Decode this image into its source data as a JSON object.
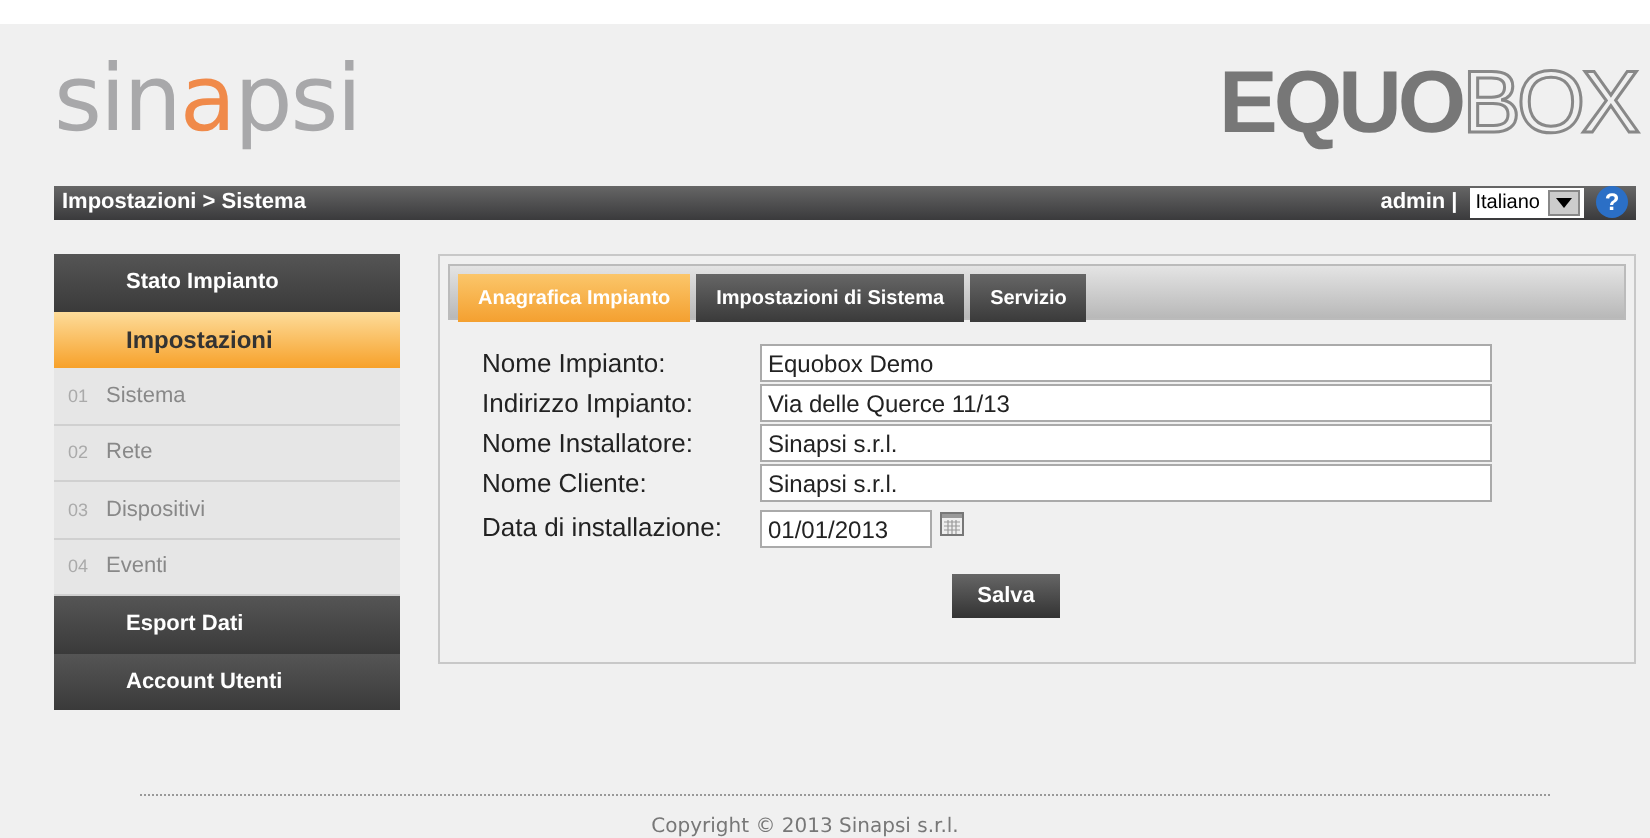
{
  "logo": {
    "parts": [
      {
        "text": "sin",
        "accent": false
      },
      {
        "text": "a",
        "accent": true
      },
      {
        "text": "psi",
        "accent": false
      }
    ]
  },
  "brand": {
    "parts": [
      {
        "text": "EQUO",
        "outline": false
      },
      {
        "text": "BOX",
        "outline": true
      }
    ]
  },
  "header": {
    "breadcrumb": "Impostazioni > Sistema",
    "user": "admin |",
    "language": "Italiano",
    "help": "?"
  },
  "sidebar": {
    "items": [
      {
        "kind": "header",
        "label": "Stato Impianto",
        "selected": false
      },
      {
        "kind": "header",
        "label": "Impostazioni",
        "selected": true
      },
      {
        "kind": "sub",
        "number": "01",
        "label": "Sistema",
        "selected": false
      },
      {
        "kind": "sub",
        "number": "02",
        "label": "Rete",
        "selected": false
      },
      {
        "kind": "sub",
        "number": "03",
        "label": "Dispositivi",
        "selected": false
      },
      {
        "kind": "sub",
        "number": "04",
        "label": "Eventi",
        "selected": false
      },
      {
        "kind": "header",
        "label": "Esport Dati",
        "selected": false
      },
      {
        "kind": "header",
        "label": "Account Utenti",
        "selected": false
      }
    ]
  },
  "tabs": [
    {
      "label": "Anagrafica Impianto",
      "selected": true
    },
    {
      "label": "Impostazioni di Sistema",
      "selected": false
    },
    {
      "label": "Servizio",
      "selected": false
    }
  ],
  "form": {
    "fields": [
      {
        "kind": "text",
        "label": "Nome Impianto:",
        "value": "Equobox Demo"
      },
      {
        "kind": "text",
        "label": "Indirizzo Impianto:",
        "value": "Via delle Querce 11/13"
      },
      {
        "kind": "text",
        "label": "Nome Installatore:",
        "value": "Sinapsi s.r.l."
      },
      {
        "kind": "text",
        "label": "Nome Cliente:",
        "value": "Sinapsi s.r.l."
      },
      {
        "kind": "date",
        "label": "Data di installazione:",
        "value": "01/01/2013"
      }
    ],
    "button": "Salva"
  },
  "footer": "Copyright © 2013 Sinapsi s.r.l."
}
